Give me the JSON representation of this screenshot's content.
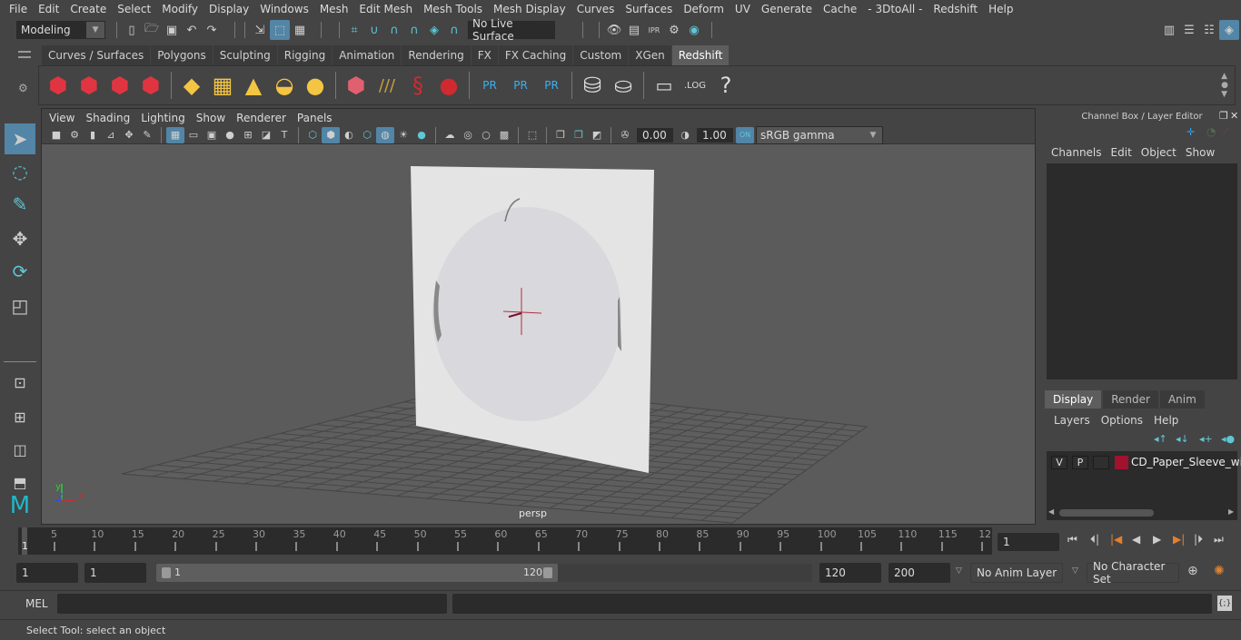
{
  "menubar": [
    "File",
    "Edit",
    "Create",
    "Select",
    "Modify",
    "Display",
    "Windows",
    "Mesh",
    "Edit Mesh",
    "Mesh Tools",
    "Mesh Display",
    "Curves",
    "Surfaces",
    "Deform",
    "UV",
    "Generate",
    "Cache",
    "- 3DtoAll -",
    "Redshift",
    "Help"
  ],
  "status_line": {
    "mode": "Modeling",
    "live_surface": "No Live Surface"
  },
  "shelf": {
    "tabs": [
      "Curves / Surfaces",
      "Polygons",
      "Sculpting",
      "Rigging",
      "Animation",
      "Rendering",
      "FX",
      "FX Caching",
      "Custom",
      "XGen",
      "Redshift"
    ],
    "active_tab": "Redshift",
    "labels": {
      "rv": "RV",
      "ipr": "IPR",
      "pr": "PR",
      "log": ".LOG",
      "help": "?"
    }
  },
  "viewport": {
    "menu": [
      "View",
      "Shading",
      "Lighting",
      "Show",
      "Renderer",
      "Panels"
    ],
    "exposure": "0.00",
    "gamma": "1.00",
    "color_space": "sRGB gamma",
    "camera_label": "persp",
    "axis": {
      "x": "x",
      "y": "y",
      "z": "z"
    }
  },
  "channel_box": {
    "title": "Channel Box / Layer Editor",
    "menu": [
      "Channels",
      "Edit",
      "Object",
      "Show"
    ]
  },
  "layer_editor": {
    "tabs": [
      "Display",
      "Render",
      "Anim"
    ],
    "active_tab": "Display",
    "menu": [
      "Layers",
      "Options",
      "Help"
    ],
    "layers": [
      {
        "v": "V",
        "p": "P",
        "color": "#a0122e",
        "name": "CD_Paper_Sleeve_with"
      }
    ]
  },
  "timeline": {
    "ticks": [
      "5",
      "10",
      "15",
      "20",
      "25",
      "30",
      "35",
      "40",
      "45",
      "50",
      "55",
      "60",
      "65",
      "70",
      "75",
      "80",
      "85",
      "90",
      "95",
      "100",
      "105",
      "110",
      "115",
      "12"
    ],
    "current_frame_marker": "1",
    "current_frame": "1"
  },
  "range": {
    "start": "1",
    "playback_start": "1",
    "slider_start": "1",
    "slider_end": "120",
    "playback_end": "120",
    "end": "200",
    "anim_layer": "No Anim Layer",
    "character_set": "No Character Set"
  },
  "command_line": {
    "label": "MEL"
  },
  "help_line": "Select Tool: select an object"
}
